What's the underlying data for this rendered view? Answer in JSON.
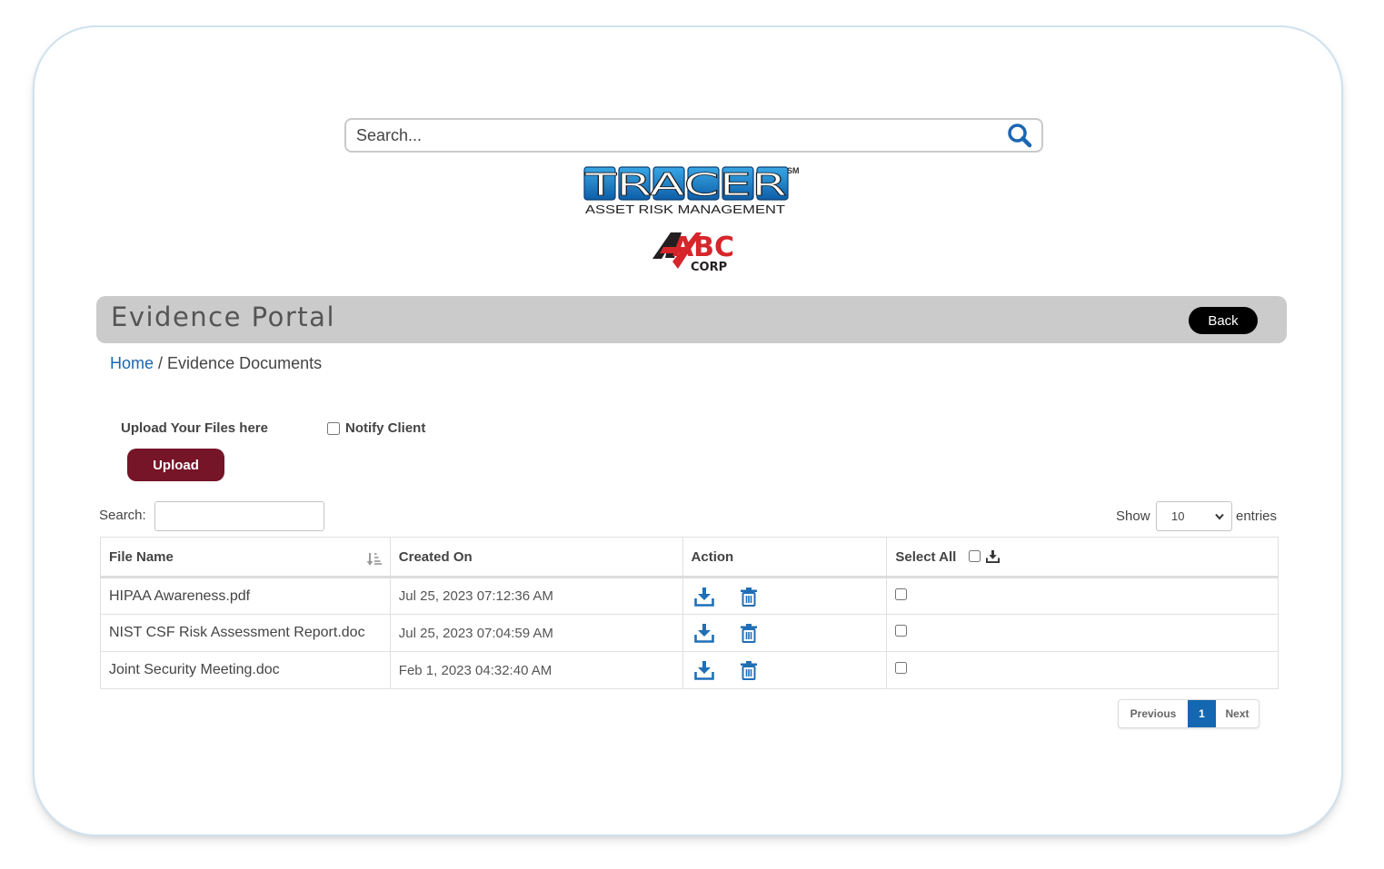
{
  "top_search": {
    "placeholder": "Search..."
  },
  "logos": {
    "tracer": {
      "text": "TRACER",
      "superscript": "SM",
      "tagline": "ASSET RISK MANAGEMENT"
    },
    "client": {
      "text": "ABC",
      "subtext": "CORP"
    }
  },
  "banner": {
    "title": "Evidence Portal",
    "back_label": "Back"
  },
  "breadcrumb": {
    "home": "Home",
    "separator": " / ",
    "current": "Evidence Documents"
  },
  "upload": {
    "label": "Upload Your Files here",
    "notify_label": "Notify Client",
    "notify_checked": false,
    "button_label": "Upload"
  },
  "table_controls": {
    "search_label": "Search:",
    "show_label": "Show",
    "page_size": "10",
    "entries_label": "entries"
  },
  "table": {
    "headers": {
      "file_name": "File Name",
      "created_on": "Created On",
      "action": "Action",
      "select_all": "Select All"
    },
    "rows": [
      {
        "file_name": "HIPAA Awareness.pdf",
        "created_on": "Jul 25, 2023 07:12:36 AM",
        "selected": false
      },
      {
        "file_name": "NIST CSF Risk Assessment Report.doc",
        "created_on": "Jul 25, 2023 07:04:59 AM",
        "selected": false
      },
      {
        "file_name": "Joint Security Meeting.doc",
        "created_on": "Feb 1, 2023 04:32:40 AM",
        "selected": false
      }
    ]
  },
  "pagination": {
    "previous": "Previous",
    "current_page": "1",
    "next": "Next"
  },
  "colors": {
    "primary_blue": "#1a66b2",
    "upload_red": "#761428",
    "banner_gray": "#cbcbcb",
    "logo_red": "#d7262b"
  },
  "icons": {
    "search": "search-icon",
    "sort": "sort-icon",
    "download": "download-icon",
    "delete": "trash-icon"
  }
}
